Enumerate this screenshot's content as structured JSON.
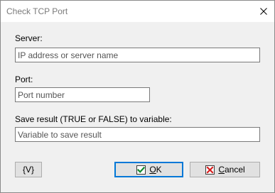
{
  "window": {
    "title": "Check TCP Port"
  },
  "form": {
    "server_label": "Server:",
    "server_value": "",
    "server_placeholder": "IP address or server name",
    "port_label": "Port:",
    "port_value": "",
    "port_placeholder": "Port number",
    "result_label": "Save result (TRUE or FALSE) to variable:",
    "result_value": "",
    "result_placeholder": "Variable to save result"
  },
  "buttons": {
    "variables_label": "{V}",
    "ok_accel": "O",
    "ok_rest": "K",
    "cancel_accel": "C",
    "cancel_rest": "ancel"
  },
  "icons": {
    "close": "close-icon",
    "ok": "green-check-icon",
    "cancel": "red-x-icon"
  },
  "colors": {
    "focus_border": "#0078d7",
    "ok_check": "#0f8a2c",
    "cancel_x": "#d81e1e"
  }
}
